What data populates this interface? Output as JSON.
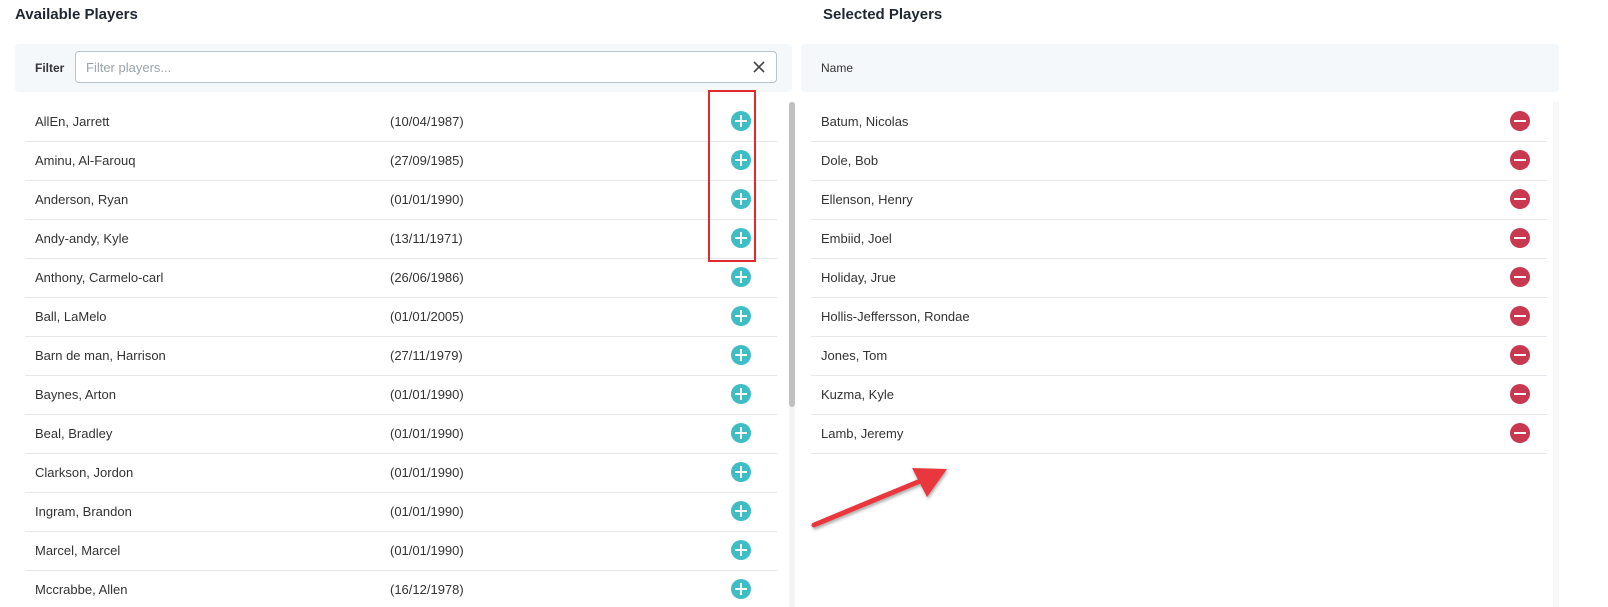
{
  "available": {
    "title": "Available Players",
    "filter_label": "Filter",
    "filter_placeholder": "Filter players...",
    "filter_value": "",
    "clear_icon": "close-icon",
    "add_icon": "plus-circle-icon",
    "players": [
      {
        "name": "AllEn, Jarrett",
        "dob": "(10/04/1987)"
      },
      {
        "name": "Aminu, Al-Farouq",
        "dob": "(27/09/1985)"
      },
      {
        "name": "Anderson, Ryan",
        "dob": "(01/01/1990)"
      },
      {
        "name": "Andy-andy, Kyle",
        "dob": "(13/11/1971)"
      },
      {
        "name": "Anthony, Carmelo-carl",
        "dob": "(26/06/1986)"
      },
      {
        "name": "Ball, LaMelo",
        "dob": "(01/01/2005)"
      },
      {
        "name": "Barn de man, Harrison",
        "dob": "(27/11/1979)"
      },
      {
        "name": "Baynes, Arton",
        "dob": "(01/01/1990)"
      },
      {
        "name": "Beal, Bradley",
        "dob": "(01/01/1990)"
      },
      {
        "name": "Clarkson, Jordon",
        "dob": "(01/01/1990)"
      },
      {
        "name": "Ingram, Brandon",
        "dob": "(01/01/1990)"
      },
      {
        "name": "Marcel, Marcel",
        "dob": "(01/01/1990)"
      },
      {
        "name": "Mccrabbe, Allen",
        "dob": "(16/12/1978)"
      }
    ]
  },
  "selected": {
    "title": "Selected Players",
    "column_header": "Name",
    "remove_icon": "minus-circle-icon",
    "players": [
      {
        "name": "Batum, Nicolas"
      },
      {
        "name": "Dole, Bob"
      },
      {
        "name": "Ellenson, Henry"
      },
      {
        "name": "Embiid, Joel"
      },
      {
        "name": "Holiday, Jrue"
      },
      {
        "name": "Hollis-Jeffersson, Rondae"
      },
      {
        "name": "Jones, Tom"
      },
      {
        "name": "Kuzma, Kyle"
      },
      {
        "name": "Lamb, Jeremy"
      }
    ]
  },
  "colors": {
    "add": "#3fbdc4",
    "remove": "#c8384f",
    "annotation": "#e02a2f"
  }
}
